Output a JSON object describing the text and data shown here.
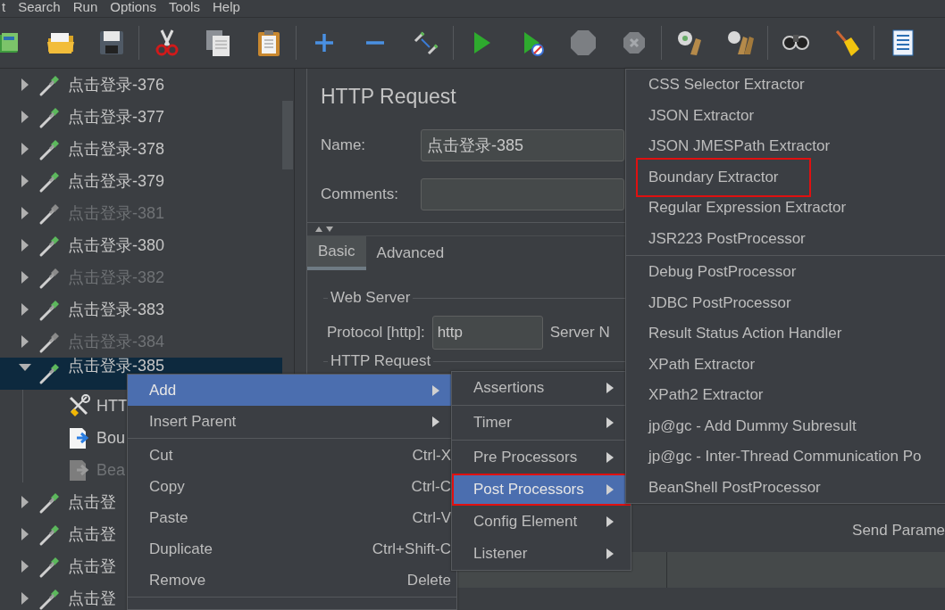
{
  "menu_bar": [
    "t",
    "Search",
    "Run",
    "Options",
    "Tools",
    "Help"
  ],
  "tree": {
    "items": [
      {
        "label": "点击登录-376",
        "kind": "sampler",
        "disabled": false,
        "selected": false,
        "expanded": false
      },
      {
        "label": "点击登录-377",
        "kind": "sampler",
        "disabled": false,
        "selected": false,
        "expanded": false
      },
      {
        "label": "点击登录-378",
        "kind": "sampler",
        "disabled": false,
        "selected": false,
        "expanded": false
      },
      {
        "label": "点击登录-379",
        "kind": "sampler",
        "disabled": false,
        "selected": false,
        "expanded": false
      },
      {
        "label": "点击登录-381",
        "kind": "sampler",
        "disabled": true,
        "selected": false,
        "expanded": false
      },
      {
        "label": "点击登录-380",
        "kind": "sampler",
        "disabled": false,
        "selected": false,
        "expanded": false
      },
      {
        "label": "点击登录-382",
        "kind": "sampler",
        "disabled": true,
        "selected": false,
        "expanded": false
      },
      {
        "label": "点击登录-383",
        "kind": "sampler",
        "disabled": false,
        "selected": false,
        "expanded": false
      },
      {
        "label": "点击登录-384",
        "kind": "sampler",
        "disabled": true,
        "selected": false,
        "expanded": false
      },
      {
        "label": "点击登录-385",
        "kind": "sampler",
        "disabled": false,
        "selected": true,
        "expanded": true,
        "children": [
          {
            "label": "HTT",
            "kind": "config",
            "disabled": false,
            "selected": false
          },
          {
            "label": "Bou",
            "kind": "extractor",
            "disabled": false,
            "selected": false
          },
          {
            "label": "Bea",
            "kind": "extractor",
            "disabled": true,
            "selected": false
          }
        ]
      },
      {
        "label": "点击登",
        "kind": "sampler",
        "disabled": false,
        "selected": false,
        "expanded": false
      },
      {
        "label": "点击登",
        "kind": "sampler",
        "disabled": false,
        "selected": false,
        "expanded": false
      },
      {
        "label": "点击登",
        "kind": "sampler",
        "disabled": false,
        "selected": false,
        "expanded": false
      },
      {
        "label": "点击登",
        "kind": "sampler",
        "disabled": false,
        "selected": false,
        "expanded": false
      }
    ]
  },
  "editor": {
    "title": "HTTP Request",
    "name_label": "Name:",
    "name_value": "点击登录-385",
    "comments_label": "Comments:",
    "tabs": [
      {
        "label": "Basic",
        "selected": true
      },
      {
        "label": "Advanced",
        "selected": false
      }
    ],
    "web_server": {
      "legend": "Web Server",
      "protocol_label": "Protocol [http]:",
      "protocol_value": "http",
      "server_label": "Server N"
    },
    "http_request": {
      "legend": "HTTP Request"
    },
    "send_parameters_label": "Send Parame"
  },
  "context_menu": {
    "items": [
      {
        "kind": "item",
        "label": "Add",
        "selected": true,
        "submenu": true
      },
      {
        "kind": "item",
        "label": "Insert Parent",
        "selected": false,
        "submenu": true
      },
      {
        "kind": "separator"
      },
      {
        "kind": "item",
        "label": "Cut",
        "shortcut": "Ctrl-X",
        "selected": false,
        "submenu": false
      },
      {
        "kind": "item",
        "label": "Copy",
        "shortcut": "Ctrl-C",
        "selected": false,
        "submenu": false
      },
      {
        "kind": "item",
        "label": "Paste",
        "shortcut": "Ctrl-V",
        "selected": false,
        "submenu": false
      },
      {
        "kind": "item",
        "label": "Duplicate",
        "shortcut": "Ctrl+Shift-C",
        "selected": false,
        "submenu": false
      },
      {
        "kind": "item",
        "label": "Remove",
        "shortcut": "Delete",
        "selected": false,
        "submenu": false
      },
      {
        "kind": "separator"
      }
    ]
  },
  "add_submenu": {
    "items": [
      {
        "kind": "item",
        "label": "Assertions",
        "selected": false,
        "submenu": true,
        "highlighted": false
      },
      {
        "kind": "separator"
      },
      {
        "kind": "item",
        "label": "Timer",
        "selected": false,
        "submenu": true,
        "highlighted": false
      },
      {
        "kind": "separator"
      },
      {
        "kind": "item",
        "label": "Pre Processors",
        "selected": false,
        "submenu": true,
        "highlighted": false
      },
      {
        "kind": "item",
        "label": "Post Processors",
        "selected": true,
        "submenu": true,
        "highlighted": true
      },
      {
        "kind": "item",
        "label": "Config Element",
        "selected": false,
        "submenu": true,
        "highlighted": false
      },
      {
        "kind": "item",
        "label": "Listener",
        "selected": false,
        "submenu": true,
        "highlighted": false
      }
    ]
  },
  "post_processors_submenu": {
    "items": [
      {
        "kind": "item",
        "label": "CSS Selector Extractor",
        "selected": false,
        "highlighted": false
      },
      {
        "kind": "item",
        "label": "JSON Extractor",
        "selected": false,
        "highlighted": false
      },
      {
        "kind": "item",
        "label": "JSON JMESPath Extractor",
        "selected": false,
        "highlighted": false
      },
      {
        "kind": "item",
        "label": "Boundary Extractor",
        "selected": false,
        "highlighted": true
      },
      {
        "kind": "item",
        "label": "Regular Expression Extractor",
        "selected": false,
        "highlighted": false
      },
      {
        "kind": "item",
        "label": "JSR223 PostProcessor",
        "selected": false,
        "highlighted": false
      },
      {
        "kind": "separator"
      },
      {
        "kind": "item",
        "label": "Debug PostProcessor",
        "selected": false,
        "highlighted": false
      },
      {
        "kind": "item",
        "label": "JDBC PostProcessor",
        "selected": false,
        "highlighted": false
      },
      {
        "kind": "item",
        "label": "Result Status Action Handler",
        "selected": false,
        "highlighted": false
      },
      {
        "kind": "item",
        "label": "XPath Extractor",
        "selected": false,
        "highlighted": false
      },
      {
        "kind": "item",
        "label": "XPath2 Extractor",
        "selected": false,
        "highlighted": false
      },
      {
        "kind": "item",
        "label": "jp@gc - Add Dummy Subresult",
        "selected": false,
        "highlighted": false
      },
      {
        "kind": "item",
        "label": "jp@gc - Inter-Thread Communication Po",
        "selected": false,
        "highlighted": false
      },
      {
        "kind": "item",
        "label": "BeanShell PostProcessor",
        "selected": false,
        "highlighted": false
      }
    ]
  }
}
